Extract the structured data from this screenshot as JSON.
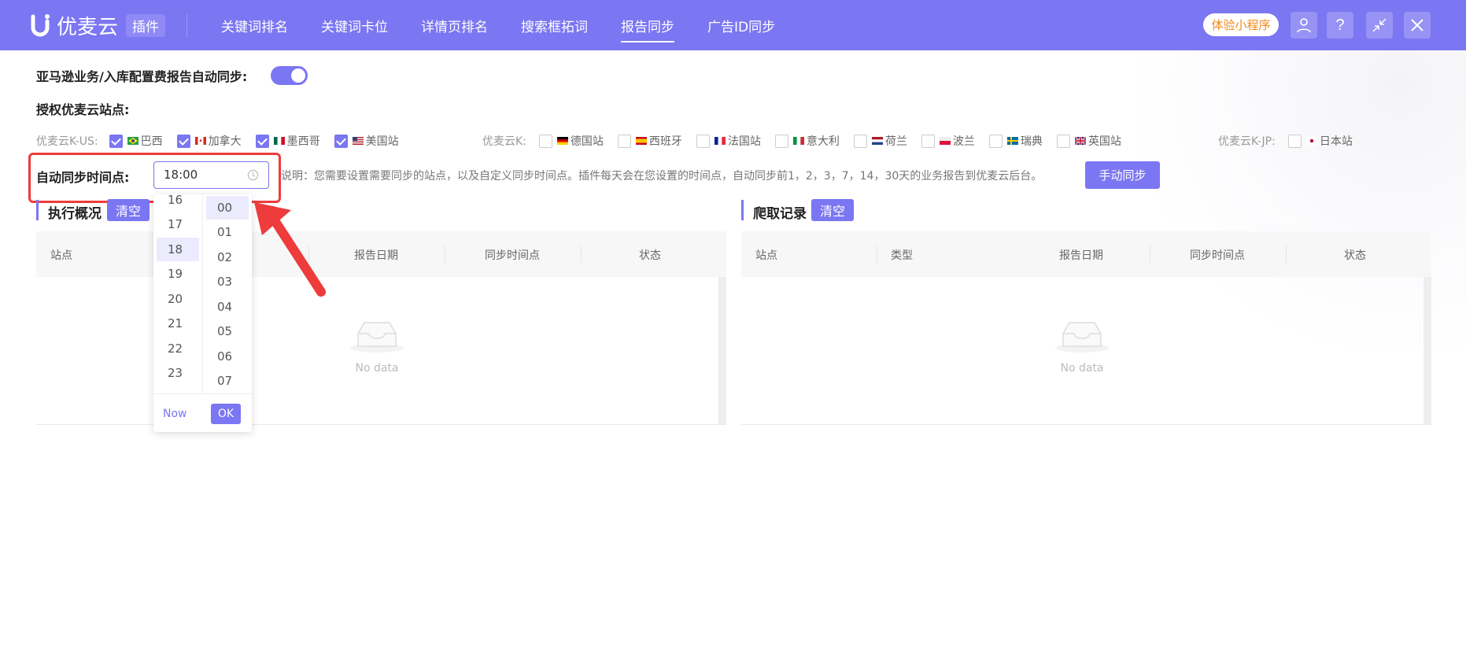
{
  "header": {
    "logo_text": "优麦云",
    "logo_badge": "插件",
    "nav": [
      "关键词排名",
      "关键词卡位",
      "详情页排名",
      "搜索框拓词",
      "报告同步",
      "广告ID同步"
    ],
    "active_nav": "报告同步",
    "mini_program_label": "体验小程序",
    "icons": [
      "user-icon",
      "help-icon",
      "collapse-icon",
      "close-icon"
    ]
  },
  "settings": {
    "auto_sync_label": "亚马逊业务/入库配置费报告自动同步:",
    "auto_sync_enabled": true,
    "authorized_sites_label": "授权优麦云站点:",
    "groups": [
      {
        "name": "优麦云K-US:",
        "sites": [
          {
            "label": "巴西",
            "checked": true
          },
          {
            "label": "加拿大",
            "checked": true
          },
          {
            "label": "墨西哥",
            "checked": true
          },
          {
            "label": "美国站",
            "checked": true
          }
        ]
      },
      {
        "name": "优麦云K:",
        "sites": [
          {
            "label": "德国站",
            "checked": false
          },
          {
            "label": "西班牙",
            "checked": false
          },
          {
            "label": "法国站",
            "checked": false
          },
          {
            "label": "意大利",
            "checked": false
          },
          {
            "label": "荷兰",
            "checked": false
          },
          {
            "label": "波兰",
            "checked": false
          },
          {
            "label": "瑞典",
            "checked": false
          },
          {
            "label": "英国站",
            "checked": false
          }
        ]
      },
      {
        "name": "优麦云K-JP:",
        "sites": [
          {
            "label": "日本站",
            "checked": false
          }
        ]
      }
    ],
    "sync_time_label": "自动同步时间点:",
    "sync_time_value": "18:00",
    "description": "说明：您需要设置需要同步的站点，以及自定义同步时间点。插件每天会在您设置的时间点，自动同步前1，2，3，7，14，30天的业务报告到优麦云后台。",
    "manual_sync_label": "手动同步"
  },
  "time_picker": {
    "hours": [
      "16",
      "17",
      "18",
      "19",
      "20",
      "21",
      "22",
      "23"
    ],
    "selected_hour": "18",
    "minutes": [
      "00",
      "01",
      "02",
      "03",
      "04",
      "05",
      "06",
      "07"
    ],
    "selected_minute": "00",
    "now_label": "Now",
    "ok_label": "OK"
  },
  "execution_panel": {
    "title": "执行概况",
    "clear_label": "清空",
    "columns": [
      "站点",
      "报告日期",
      "同步时间点",
      "状态"
    ],
    "empty_text": "No data"
  },
  "crawl_panel": {
    "title": "爬取记录",
    "clear_label": "清空",
    "columns": [
      "站点",
      "类型",
      "报告日期",
      "同步时间点",
      "状态"
    ],
    "empty_text": "No data"
  },
  "colors": {
    "accent": "#7b76f2",
    "highlight": "#ee3b3b",
    "mini_program": "#f08a1f"
  }
}
